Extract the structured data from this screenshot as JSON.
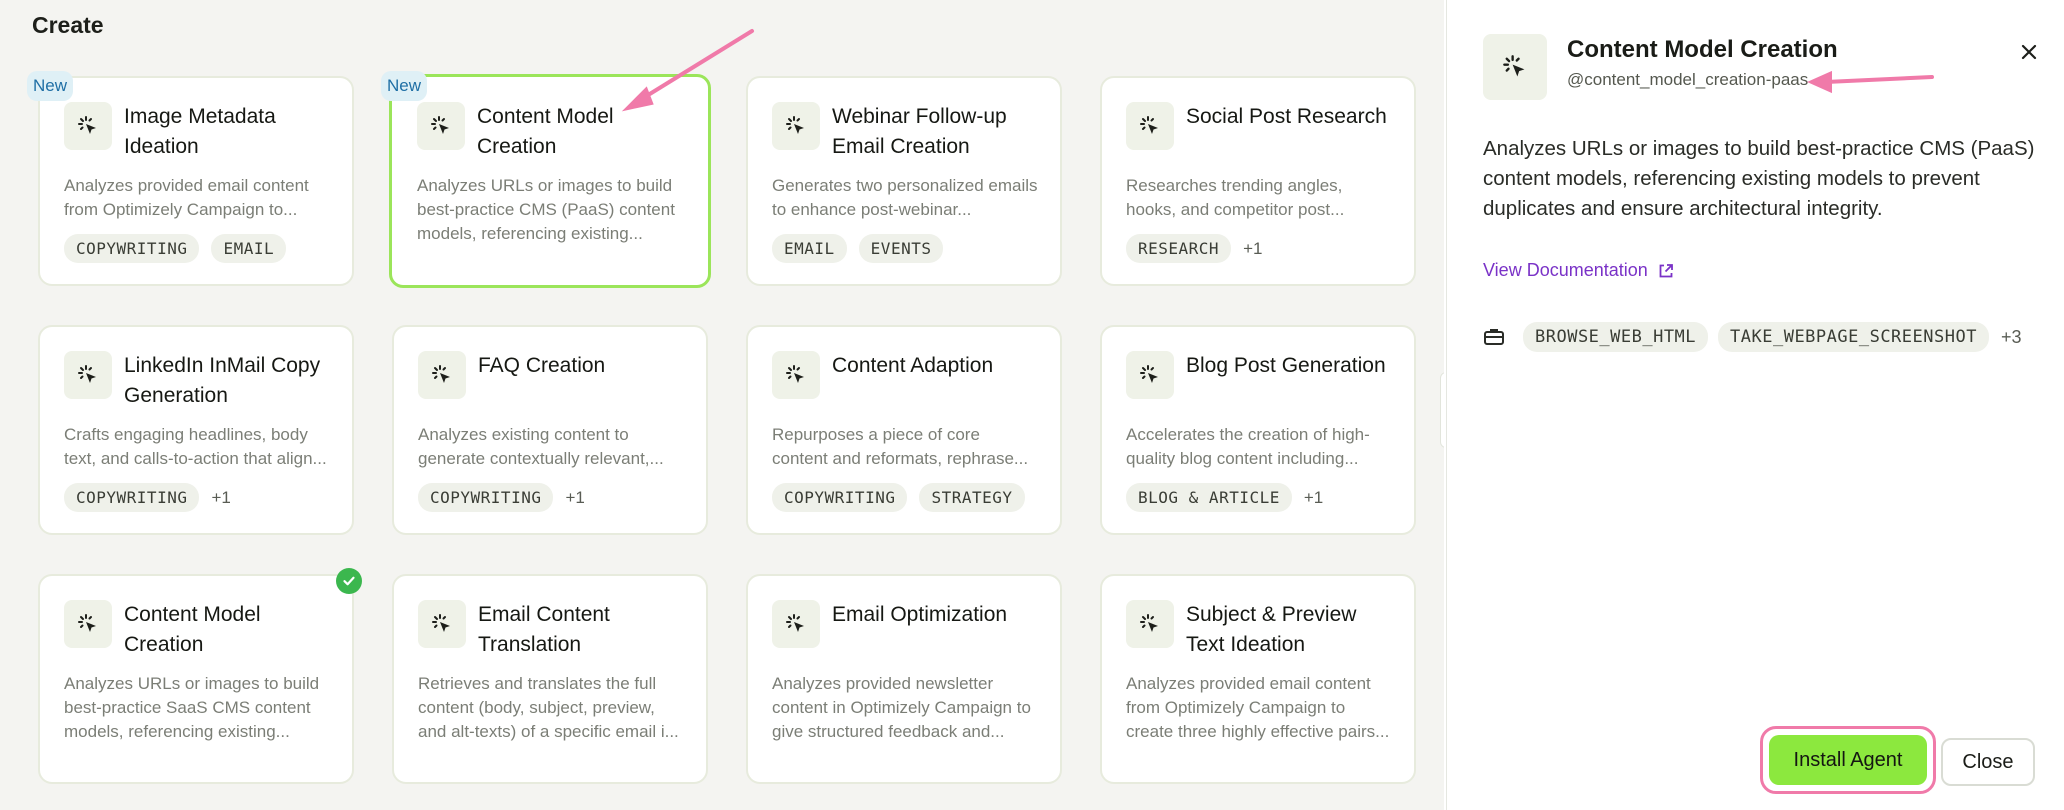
{
  "gallery": {
    "title": "Create",
    "new_badge": "New",
    "cards": [
      {
        "title": "Image Metadata Ideation",
        "description": "Analyzes provided email content from Optimizely Campaign to...",
        "tags": [
          "COPYWRITING",
          "EMAIL"
        ],
        "more": ""
      },
      {
        "title": "Content Model Creation",
        "description": "Analyzes URLs or images to build best-practice CMS (PaaS) content models, referencing existing...",
        "tags": [],
        "more": ""
      },
      {
        "title": "Webinar Follow-up Email Creation",
        "description": "Generates two personalized emails to enhance post-webinar...",
        "tags": [
          "EMAIL",
          "EVENTS"
        ],
        "more": ""
      },
      {
        "title": "Social Post Research",
        "description": "Researches trending angles, hooks, and competitor post...",
        "tags": [
          "RESEARCH"
        ],
        "more": "+1"
      },
      {
        "title": "LinkedIn InMail Copy Generation",
        "description": "Crafts engaging headlines, body text, and calls-to-action that align...",
        "tags": [
          "COPYWRITING"
        ],
        "more": "+1"
      },
      {
        "title": "FAQ Creation",
        "description": "Analyzes existing content to generate contextually relevant,...",
        "tags": [
          "COPYWRITING"
        ],
        "more": "+1"
      },
      {
        "title": "Content Adaption",
        "description": "Repurposes a piece of core content and reformats, rephrase...",
        "tags": [
          "COPYWRITING",
          "STRATEGY"
        ],
        "more": ""
      },
      {
        "title": "Blog Post Generation",
        "description": "Accelerates the creation of high-quality blog content including...",
        "tags": [
          "BLOG & ARTICLE"
        ],
        "more": "+1"
      },
      {
        "title": "Content Model Creation",
        "description": "Analyzes URLs or images to build best-practice SaaS CMS content models, referencing existing...",
        "tags": [],
        "more": ""
      },
      {
        "title": "Email Content Translation",
        "description": "Retrieves and translates the full content (body, subject, preview, and alt-texts) of a specific email i...",
        "tags": [],
        "more": ""
      },
      {
        "title": "Email Optimization",
        "description": "Analyzes provided newsletter content in Optimizely Campaign to give structured feedback and...",
        "tags": [],
        "more": ""
      },
      {
        "title": "Subject & Preview Text Ideation",
        "description": "Analyzes provided email content from Optimizely Campaign to create three highly effective pairs...",
        "tags": [],
        "more": ""
      }
    ]
  },
  "panel": {
    "title": "Content Model Creation",
    "handle": "@content_model_creation-paas",
    "description": "Analyzes URLs or images to build best-practice CMS (PaaS) content models, referencing existing models to prevent duplicates and ensure architectural integrity.",
    "doc_link": "View Documentation",
    "tools": [
      "BROWSE_WEB_HTML",
      "TAKE_WEBPAGE_SCREENSHOT"
    ],
    "tools_more": "+3",
    "install_label": "Install Agent",
    "close_label": "Close"
  },
  "colors": {
    "accent_green": "#8ce83e",
    "selected_border": "#9be55a",
    "annotation_pink": "#f07aa9",
    "link_purple": "#7a32c7",
    "new_badge_bg": "#dff0f6",
    "check_green": "#3bb74e"
  },
  "icons": {
    "agent": "sparkle-cursor-icon",
    "close": "close-icon",
    "external": "external-link-icon",
    "tools": "toolbox-icon",
    "installed": "check-icon"
  }
}
